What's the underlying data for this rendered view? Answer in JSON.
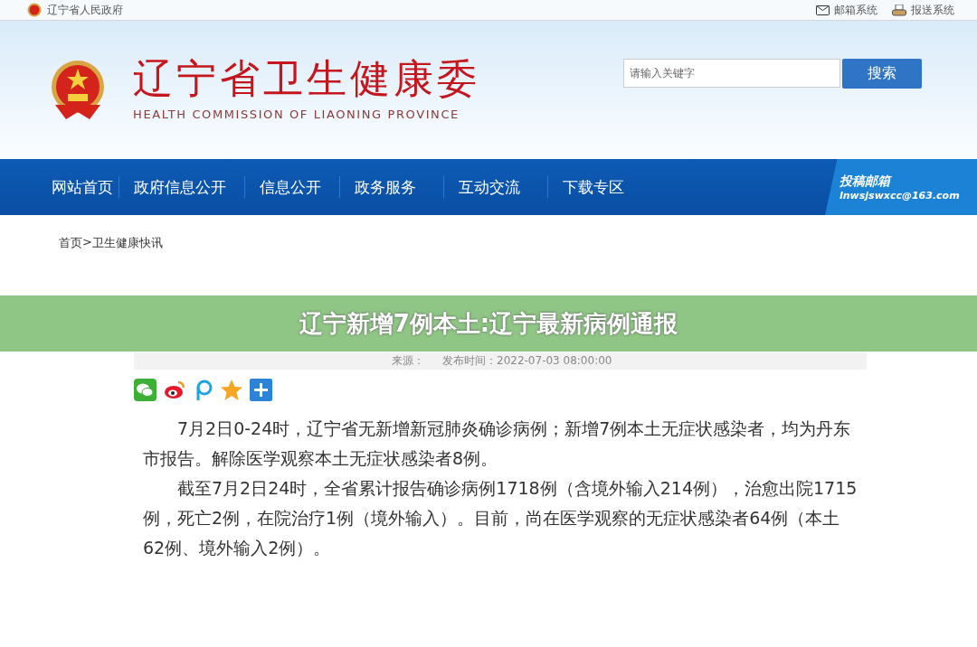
{
  "top_bar": {
    "site_link": "辽宁省人民政府",
    "links": [
      {
        "kind": "mail",
        "label": "邮箱系统"
      },
      {
        "kind": "report",
        "label": "报送系统"
      }
    ]
  },
  "header": {
    "title": "辽宁省卫生健康委",
    "subtitle": "HEALTH COMMISSION OF LIAONING PROVINCE",
    "search": {
      "placeholder": "请输入关键字",
      "button": "搜索"
    }
  },
  "nav": {
    "items": [
      "网站首页",
      "政府信息公开",
      "信息公开",
      "政务服务",
      "互动交流",
      "下载专区"
    ],
    "mailbox": {
      "label": "投稿邮箱",
      "email": "lnwsjswxcc@163.com"
    }
  },
  "breadcrumb": [
    "首页",
    ">",
    "卫生健康快讯"
  ],
  "overlay_banner": "辽宁新增7例本土:辽宁最新病例通报",
  "article": {
    "meta": {
      "source": "来源：",
      "published": "发布时间：2022-07-03 08:00:00"
    },
    "share": [
      {
        "kind": "wechat"
      },
      {
        "kind": "weibo"
      },
      {
        "kind": "p"
      },
      {
        "kind": "qzone"
      },
      {
        "kind": "more"
      }
    ],
    "paragraphs": [
      "7月2日0-24时，辽宁省无新增新冠肺炎确诊病例；新增7例本土无症状感染者，均为丹东市报告。解除医学观察本土无症状感染者8例。",
      "截至7月2日24时，全省累计报告确诊病例1718例（含境外输入214例），治愈出院1715例，死亡2例，在院治疗1例（境外输入）。目前，尚在医学观察的无症状感染者64例（本土62例、境外输入2例）。"
    ]
  }
}
